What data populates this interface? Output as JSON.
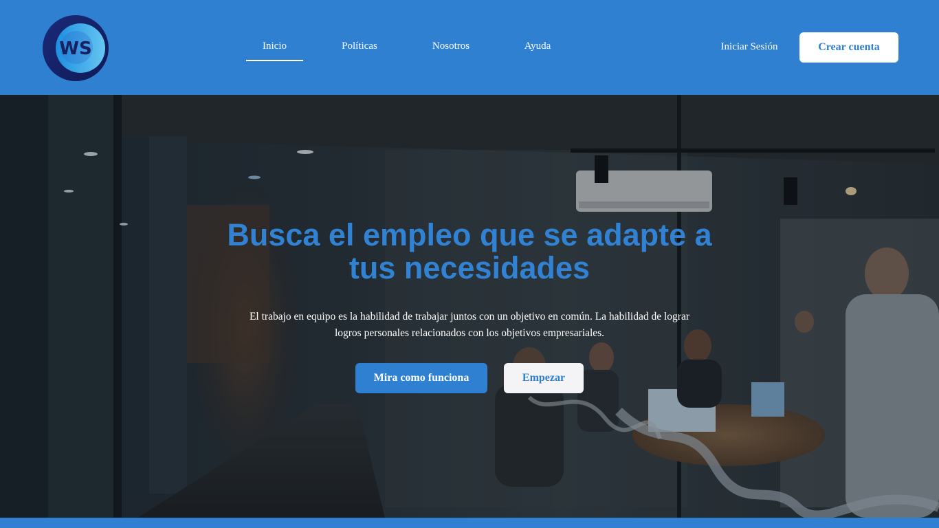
{
  "brand": {
    "logo_text": "WS",
    "colors": {
      "primary": "#2f80d1",
      "title_blue": "#3182d3",
      "white": "#ffffff"
    }
  },
  "nav": {
    "items": [
      {
        "label": "Inicio",
        "active": true
      },
      {
        "label": "Políticas",
        "active": false
      },
      {
        "label": "Nosotros",
        "active": false
      },
      {
        "label": "Ayuda",
        "active": false
      }
    ],
    "login_label": "Iniciar Sesión",
    "signup_label": "Crear cuenta"
  },
  "hero": {
    "title_line1": "Busca el empleo que se adapte a",
    "title_line2": "tus necesidades",
    "text_line1": "El trabajo en equipo es la habilidad de trabajar juntos con un objetivo en común. La habilidad de lograr",
    "text_line2": "logros personales relacionados con los objetivos empresariales.",
    "primary_button": "Mira como funciona",
    "secondary_button": "Empezar"
  }
}
